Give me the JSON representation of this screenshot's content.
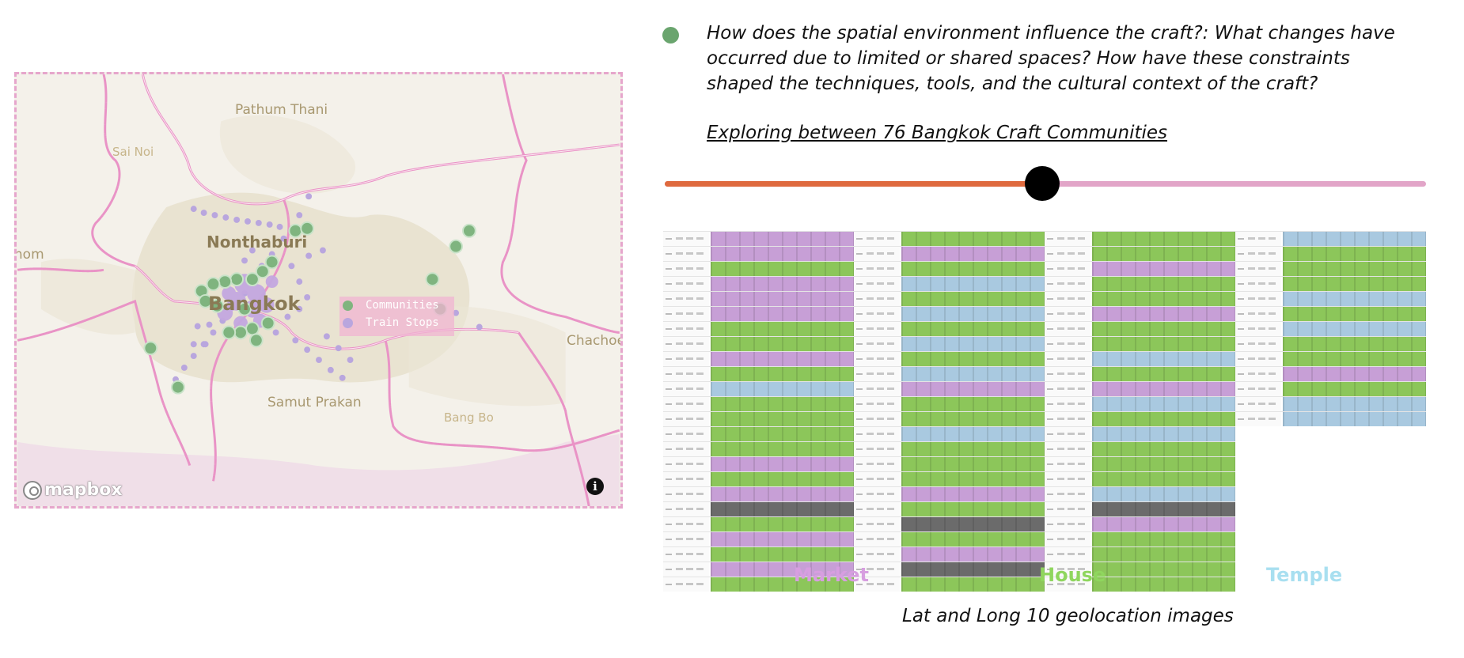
{
  "map": {
    "places": [
      "Pathum Thani",
      "Sai Noi",
      "Nonthaburi",
      "Bangkok",
      "Samut Prakan",
      "Bang Bo",
      "Chachoengsao",
      "Nakhon Pathom"
    ],
    "legend": {
      "communities": {
        "label": "Communities",
        "color": "#7fb47f"
      },
      "train_stops": {
        "label": "Train Stops",
        "color": "#b9a6de"
      }
    },
    "attribution": "mapbox",
    "info_icon": "info-icon",
    "colors": {
      "boundary": "#e993c6",
      "urban": "#e3decb",
      "land": "#f4f1ea",
      "water": "#f0dfe8",
      "frame": "#e6a6cc"
    }
  },
  "question": {
    "bullet_color": "#6aa56e",
    "text": "How does the spatial environment influence the craft?: What changes have occurred due to limited or shared spaces? How have these constraints shaped the techniques, tools, and the cultural context of the craft?",
    "exploring": "Exploring  between 76 Bangkok Craft Communities"
  },
  "slider": {
    "value_fraction": 0.496,
    "fill_color": "#df6a3e",
    "rail_color": "#e2a5c8",
    "thumb_color": "#000000"
  },
  "grid": {
    "colors": {
      "M": "#c79fd6",
      "H": "#8cc65a",
      "T": "#a9c9e0",
      "D": "#6b6b6b"
    },
    "columns": [
      {
        "rows": [
          "M",
          "M",
          "H",
          "M",
          "M",
          "M",
          "H",
          "H",
          "M",
          "H",
          "T",
          "H",
          "H",
          "H",
          "H",
          "M",
          "H",
          "M",
          "D",
          "H",
          "M",
          "H",
          "M",
          "H"
        ]
      },
      {
        "rows": [
          "H",
          "M",
          "H",
          "T",
          "H",
          "T",
          "H",
          "T",
          "H",
          "T",
          "M",
          "H",
          "H",
          "T",
          "H",
          "H",
          "H",
          "M",
          "H",
          "D",
          "H",
          "M",
          "D",
          "H"
        ]
      },
      {
        "rows": [
          "H",
          "H",
          "M",
          "H",
          "H",
          "M",
          "H",
          "H",
          "T",
          "H",
          "M",
          "T",
          "H",
          "T",
          "H",
          "H",
          "H",
          "T",
          "D",
          "M",
          "H",
          "H",
          "H",
          "H"
        ]
      },
      {
        "rows": [
          "T",
          "H",
          "H",
          "H",
          "T",
          "H",
          "T",
          "H",
          "H",
          "M",
          "H",
          "T",
          "T"
        ]
      }
    ],
    "legend": {
      "market": {
        "label": "Market",
        "color": "#d79ee0"
      },
      "house": {
        "label": "House",
        "color": "#8fd65e"
      },
      "temple": {
        "label": "Temple",
        "color": "#a8dff0"
      }
    },
    "caption": "Lat and Long 10  geolocation images"
  }
}
